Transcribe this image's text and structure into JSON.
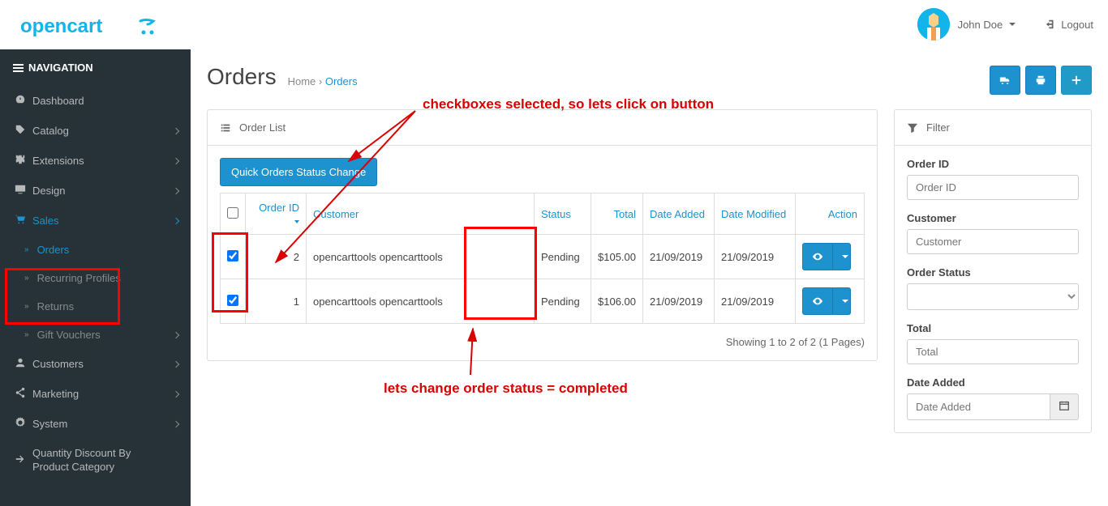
{
  "header": {
    "username": "John Doe",
    "logout_label": "Logout"
  },
  "sidebar": {
    "title": "NAVIGATION",
    "items": [
      {
        "label": "Dashboard"
      },
      {
        "label": "Catalog"
      },
      {
        "label": "Extensions"
      },
      {
        "label": "Design"
      },
      {
        "label": "Sales",
        "active": true
      },
      {
        "label": "Customers"
      },
      {
        "label": "Marketing"
      },
      {
        "label": "System"
      },
      {
        "label": "Quantity Discount By Product Category"
      }
    ],
    "sales_submenu": [
      {
        "label": "Orders",
        "active": true
      },
      {
        "label": "Recurring Profiles"
      },
      {
        "label": "Returns"
      },
      {
        "label": "Gift Vouchers"
      }
    ]
  },
  "page": {
    "title": "Orders",
    "breadcrumb_home": "Home",
    "breadcrumb_current": "Orders"
  },
  "order_list": {
    "panel_title": "Order List",
    "quick_button": "Quick Orders Status Change",
    "headers": {
      "order_id": "Order ID",
      "customer": "Customer",
      "status": "Status",
      "total": "Total",
      "date_added": "Date Added",
      "date_modified": "Date Modified",
      "action": "Action"
    },
    "rows": [
      {
        "id": "2",
        "customer": "opencarttools opencarttools",
        "status": "Pending",
        "total": "$105.00",
        "date_added": "21/09/2019",
        "date_modified": "21/09/2019",
        "checked": true
      },
      {
        "id": "1",
        "customer": "opencarttools opencarttools",
        "status": "Pending",
        "total": "$106.00",
        "date_added": "21/09/2019",
        "date_modified": "21/09/2019",
        "checked": true
      }
    ],
    "pagination": "Showing 1 to 2 of 2 (1 Pages)"
  },
  "filter": {
    "panel_title": "Filter",
    "order_id_label": "Order ID",
    "order_id_placeholder": "Order ID",
    "customer_label": "Customer",
    "customer_placeholder": "Customer",
    "order_status_label": "Order Status",
    "total_label": "Total",
    "total_placeholder": "Total",
    "date_added_label": "Date Added",
    "date_added_placeholder": "Date Added"
  },
  "annotations": {
    "top_text": "checkboxes selected, so lets click on button",
    "bottom_text": "lets change order status = completed"
  }
}
